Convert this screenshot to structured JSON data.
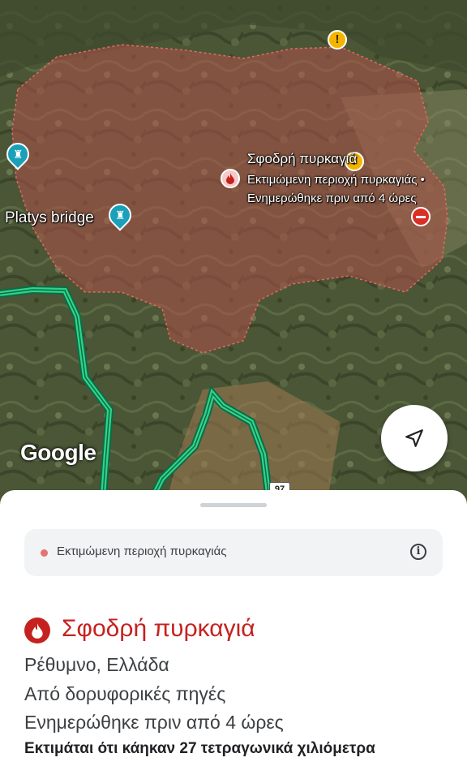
{
  "map": {
    "fire_label_title": "Σφοδρή πυρκαγιά",
    "fire_label_line1": "Εκτιμώμενη περιοχή πυρκαγιάς •",
    "fire_label_line2": "Ενημερώθηκε πριν από 4 ώρες",
    "poi_label": "Platys bridge",
    "logo_text": "Google",
    "route_number": "97",
    "colors": {
      "fire_area": "#b0524a",
      "route": "#2fd38a",
      "warning": "#f5b400",
      "closed": "#d93025"
    }
  },
  "sheet": {
    "chip_label": "Εκτιμώμενη περιοχή πυρκαγιάς",
    "title": "Σφοδρή πυρκαγιά",
    "location": "Ρέθυμνο, Ελλάδα",
    "source": "Από δορυφορικές πηγές",
    "updated": "Ενημερώθηκε πριν από 4 ώρες",
    "burned_area": "Εκτιμάται ότι κάηκαν 27 τετραγωνικά χιλιόμετρα",
    "title_color": "#c5221f"
  }
}
